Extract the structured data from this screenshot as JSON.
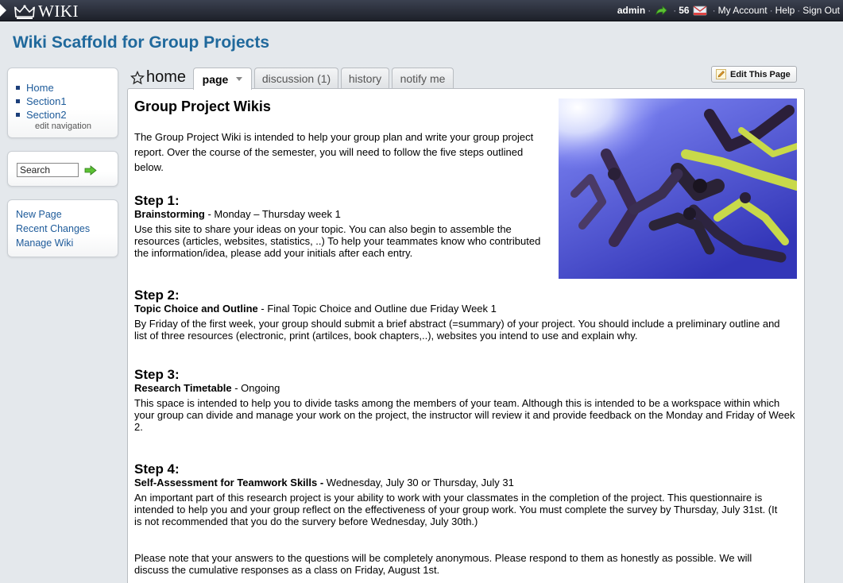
{
  "topbar": {
    "logo_text": "WIKI",
    "username": "admin",
    "message_count": "56",
    "my_account": "My Account",
    "help": "Help",
    "sign_out": "Sign Out"
  },
  "site_title": "Wiki Scaffold for Group Projects",
  "sidebar": {
    "nav_items": [
      {
        "label": "Home"
      },
      {
        "label": "Section1"
      },
      {
        "label": "Section2"
      }
    ],
    "edit_navigation": "edit navigation",
    "search_value": "Search",
    "tools": [
      {
        "label": "New Page"
      },
      {
        "label": "Recent Changes"
      },
      {
        "label": "Manage Wiki"
      }
    ]
  },
  "page": {
    "name": "home",
    "tabs": [
      {
        "label": "page"
      },
      {
        "label": "discussion (1)"
      },
      {
        "label": "history"
      },
      {
        "label": "notify me"
      }
    ],
    "edit_button": "Edit This Page"
  },
  "content": {
    "title": "Group Project Wikis",
    "intro_lines": [
      "The Group Project Wiki is intended to help your group plan and write your group project",
      "report. Over the course of the semester, you will need to follow the five steps outlined",
      "below."
    ],
    "steps": [
      {
        "heading": "Step 1:",
        "sub_bold": "Brainstorming",
        "sub_rest": " - Monday – Thursday week 1",
        "lines": [
          "Use this site to share your ideas on your topic. You can also begin to assemble the",
          "resources (articles, websites, statistics, ..) To help your teammates know who contributed",
          "the information/idea, please add your initials after each entry."
        ]
      },
      {
        "heading": "Step 2:",
        "sub_bold": "Topic Choice and Outline",
        "sub_rest": " - Final Topic Choice and Outline due Friday Week 1",
        "lines": [
          "By Friday of the first week, your group should submit a brief abstract (=summary) of your project. You should include a preliminary outline and",
          "list of three resources (electronic, print (artilces, book chapters,..), websites you intend to use and explain why."
        ]
      },
      {
        "heading": "Step 3:",
        "sub_bold": "Research Timetable",
        "sub_rest": " - Ongoing",
        "lines": [
          "This space is intended to help you to divide tasks among the members of your team. Although this is intended to be a workspace within which",
          "your group can divide and manage your work on the project, the instructor will review it and provide feedback on the Monday and Friday of Week",
          "2."
        ]
      },
      {
        "heading": "Step 4:",
        "sub_bold": "Self-Assessment for Teamwork Skills -",
        "sub_rest": " Wednesday, July 30 or Thursday, July 31",
        "lines": [
          "An important part of this research project is your ability to work with your classmates in the completion of the project. This questionnaire is",
          "intended to help you and your group reflect on the effectiveness of your group work. You must complete the survey by Thursday, July 31st. (It",
          "is not recommended that you do the survery before Wednesday, July 30th.)"
        ]
      }
    ],
    "closing_lines": [
      "Please note that your answers to the questions will be completely anonymous. Please respond to them as honestly as possible. We will",
      "discuss the cumulative responses as a class on Friday, August 1st."
    ]
  },
  "colors": {
    "accent": "#20699c",
    "link": "#1e5b9a",
    "topbar": "#262a35"
  }
}
